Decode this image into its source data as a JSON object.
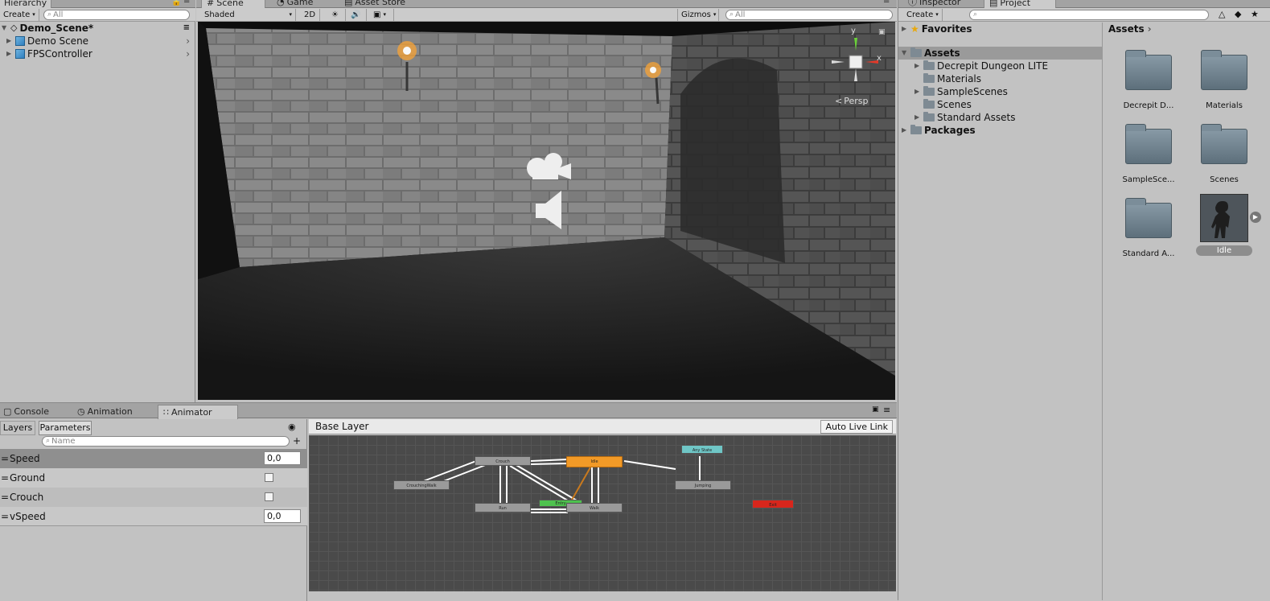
{
  "hierarchy": {
    "tab": "Hierarchy",
    "create": "Create",
    "search_placeholder": "All",
    "scene": "Demo_Scene*",
    "items": [
      {
        "label": "Demo Scene"
      },
      {
        "label": "FPSController"
      }
    ]
  },
  "scene_tabs": {
    "scene": "Scene",
    "game": "Game",
    "asset_store": "Asset Store"
  },
  "scene_toolbar": {
    "shading": "Shaded",
    "mode_2d": "2D",
    "gizmos": "Gizmos",
    "search_placeholder": "All",
    "persp": "Persp",
    "axis_y": "y",
    "axis_x": "x"
  },
  "right_tabs": {
    "inspector": "Inspector",
    "project": "Project"
  },
  "project": {
    "create": "Create",
    "favorites": "Favorites",
    "assets": "Assets",
    "tree": [
      {
        "label": "Decrepit Dungeon LITE"
      },
      {
        "label": "Materials"
      },
      {
        "label": "SampleScenes"
      },
      {
        "label": "Scenes"
      },
      {
        "label": "Standard Assets"
      }
    ],
    "packages": "Packages",
    "breadcrumb": "Assets",
    "grid": [
      {
        "label": "Decrepit D..."
      },
      {
        "label": "Materials"
      },
      {
        "label": "SampleSce..."
      },
      {
        "label": "Scenes"
      },
      {
        "label": "Standard A..."
      },
      {
        "label": "Idle"
      }
    ]
  },
  "bottom_tabs": {
    "console": "Console",
    "animation": "Animation",
    "animator": "Animator"
  },
  "animator": {
    "layers_tab": "Layers",
    "parameters_tab": "Parameters",
    "search_placeholder": "Name",
    "params": [
      {
        "name": "Speed",
        "value": "0,0",
        "type": "float"
      },
      {
        "name": "Ground",
        "value": "",
        "type": "bool"
      },
      {
        "name": "Crouch",
        "value": "",
        "type": "bool"
      },
      {
        "name": "vSpeed",
        "value": "0,0",
        "type": "float"
      }
    ],
    "breadcrumb": "Base Layer",
    "auto_live_link": "Auto Live Link",
    "nodes": {
      "crouch": "Crouch",
      "idle": "Idle",
      "any_state": "Any State",
      "crouching_walk": "CrouchingWalk",
      "jumping": "Jumping",
      "run": "Run",
      "entry": "Entry",
      "walk": "Walk",
      "exit": "Exit"
    }
  },
  "colors": {
    "node_default": "#9a9a9a",
    "node_idle": "#f29a27",
    "node_any": "#6fc6c6",
    "node_entry": "#4ec24e",
    "node_exit": "#d8261c",
    "grid_bg": "#4a4a4a"
  }
}
